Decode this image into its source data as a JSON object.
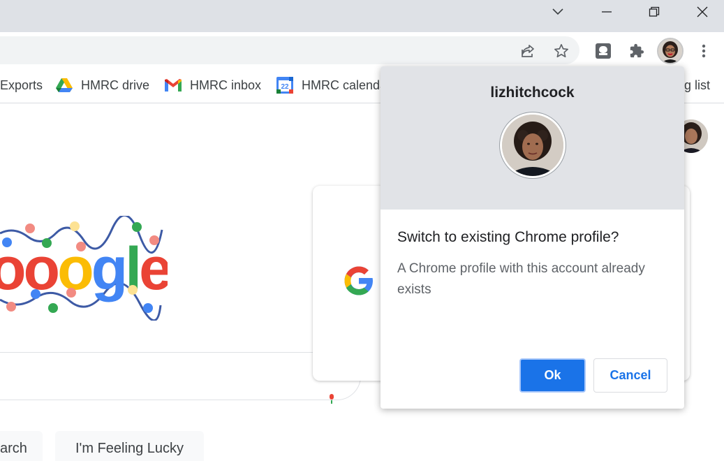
{
  "window_controls": {
    "tab_search": "tab-search",
    "minimize": "minimize",
    "restore": "restore",
    "close": "close"
  },
  "toolbar": {
    "share_icon": "share-icon",
    "bookmark_star_icon": "star-icon",
    "extension_icon": "puzzle-icon",
    "menu_icon": "kebab-menu-icon"
  },
  "bookmarks": {
    "items": [
      {
        "label": "Exports",
        "icon": "none"
      },
      {
        "label": "HMRC drive",
        "icon": "drive-icon"
      },
      {
        "label": "HMRC inbox",
        "icon": "gmail-icon"
      },
      {
        "label": "HMRC calenda",
        "icon": "calendar-icon",
        "icon_text": "22"
      },
      {
        "label": "g list",
        "icon": "none"
      }
    ]
  },
  "google_page": {
    "doodle_text": "oogle",
    "buttons": {
      "search": "arch",
      "lucky": "I'm Feeling Lucky"
    }
  },
  "dialog": {
    "profile_name": "lizhitchcock",
    "title": "Switch to existing Chrome profile?",
    "message": "A Chrome profile with this account already exists",
    "ok_label": "Ok",
    "cancel_label": "Cancel"
  },
  "colors": {
    "accent": "#1a73e8",
    "header_bg": "#e1e3e7",
    "titlebar_bg": "#dee1e6"
  }
}
